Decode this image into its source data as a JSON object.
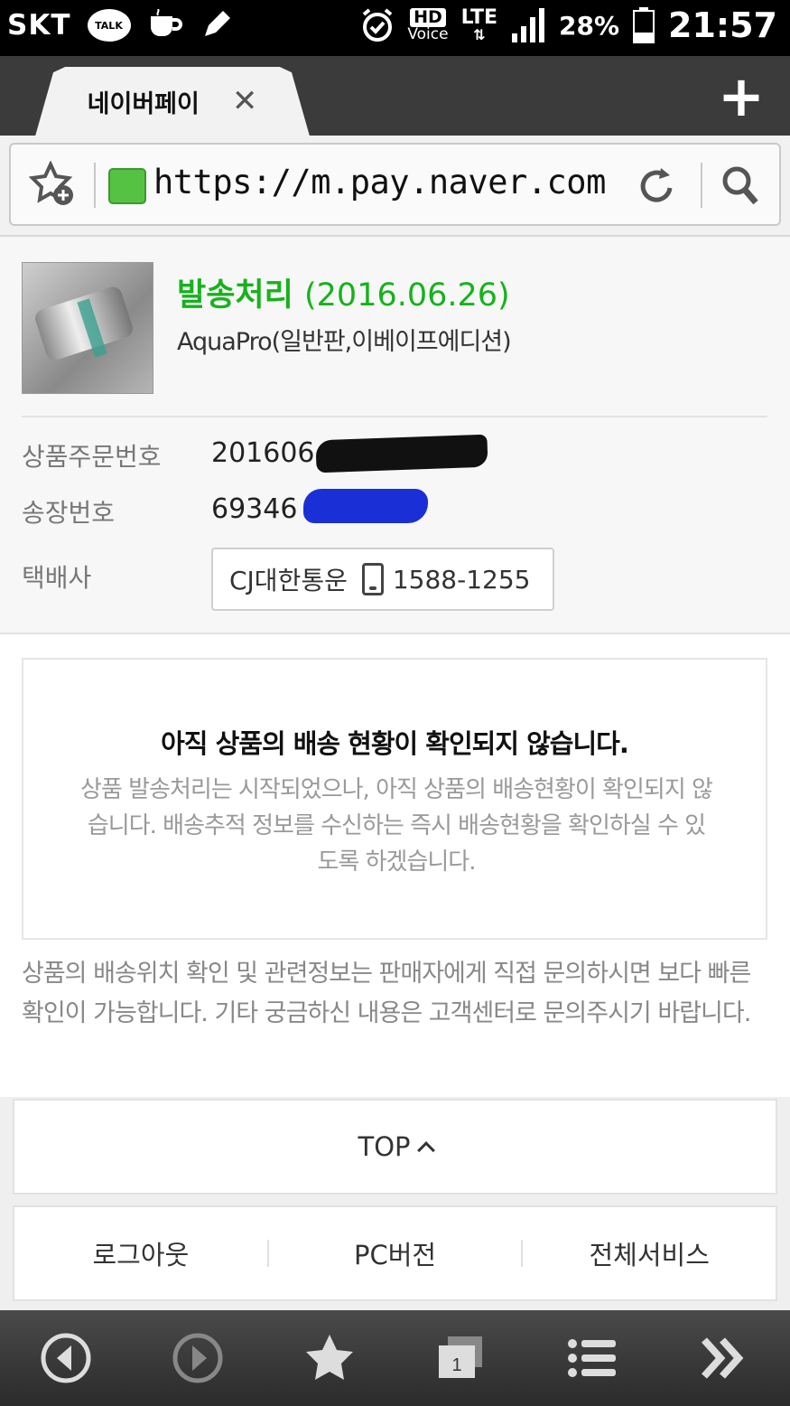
{
  "status_bar": {
    "carrier": "SKT",
    "talk_label": "TALK",
    "hd_label": "HD",
    "voice_label": "Voice",
    "network": "LTE",
    "battery": "28%",
    "time": "21:57"
  },
  "browser": {
    "tab_title": "네이버페이",
    "url": "https://m.pay.naver.com/c"
  },
  "order": {
    "status": "발송처리",
    "status_date": "(2016.06.26)",
    "product_name": "AquaPro(일반판,이베이프에디션)",
    "order_number_label": "상품주문번호",
    "order_number": "201606",
    "tracking_label": "송장번호",
    "tracking_number": "69346",
    "courier_label": "택배사",
    "courier_name": "CJ대한통운",
    "courier_phone": "1588-1255"
  },
  "notice": {
    "title": "아직 상품의 배송 현황이 확인되지 않습니다.",
    "body": "상품 발송처리는 시작되었으나, 아직 상품의 배송현황이 확인되지 않습니다. 배송추적 정보를 수신하는 즉시 배송현황을 확인하실 수 있도록 하겠습니다."
  },
  "info_text": "상품의 배송위치 확인 및 관련정보는 판매자에게 직접 문의하시면 보다 빠른 확인이 가능합니다. 기타 궁금하신 내용은 고객센터로 문의주시기 바랍니다.",
  "footer": {
    "top_label": "TOP",
    "logout": "로그아웃",
    "pc_version": "PC버전",
    "all_services": "전체서비스"
  },
  "colors": {
    "status_green": "#16b21c",
    "lock_green": "#55c244"
  }
}
